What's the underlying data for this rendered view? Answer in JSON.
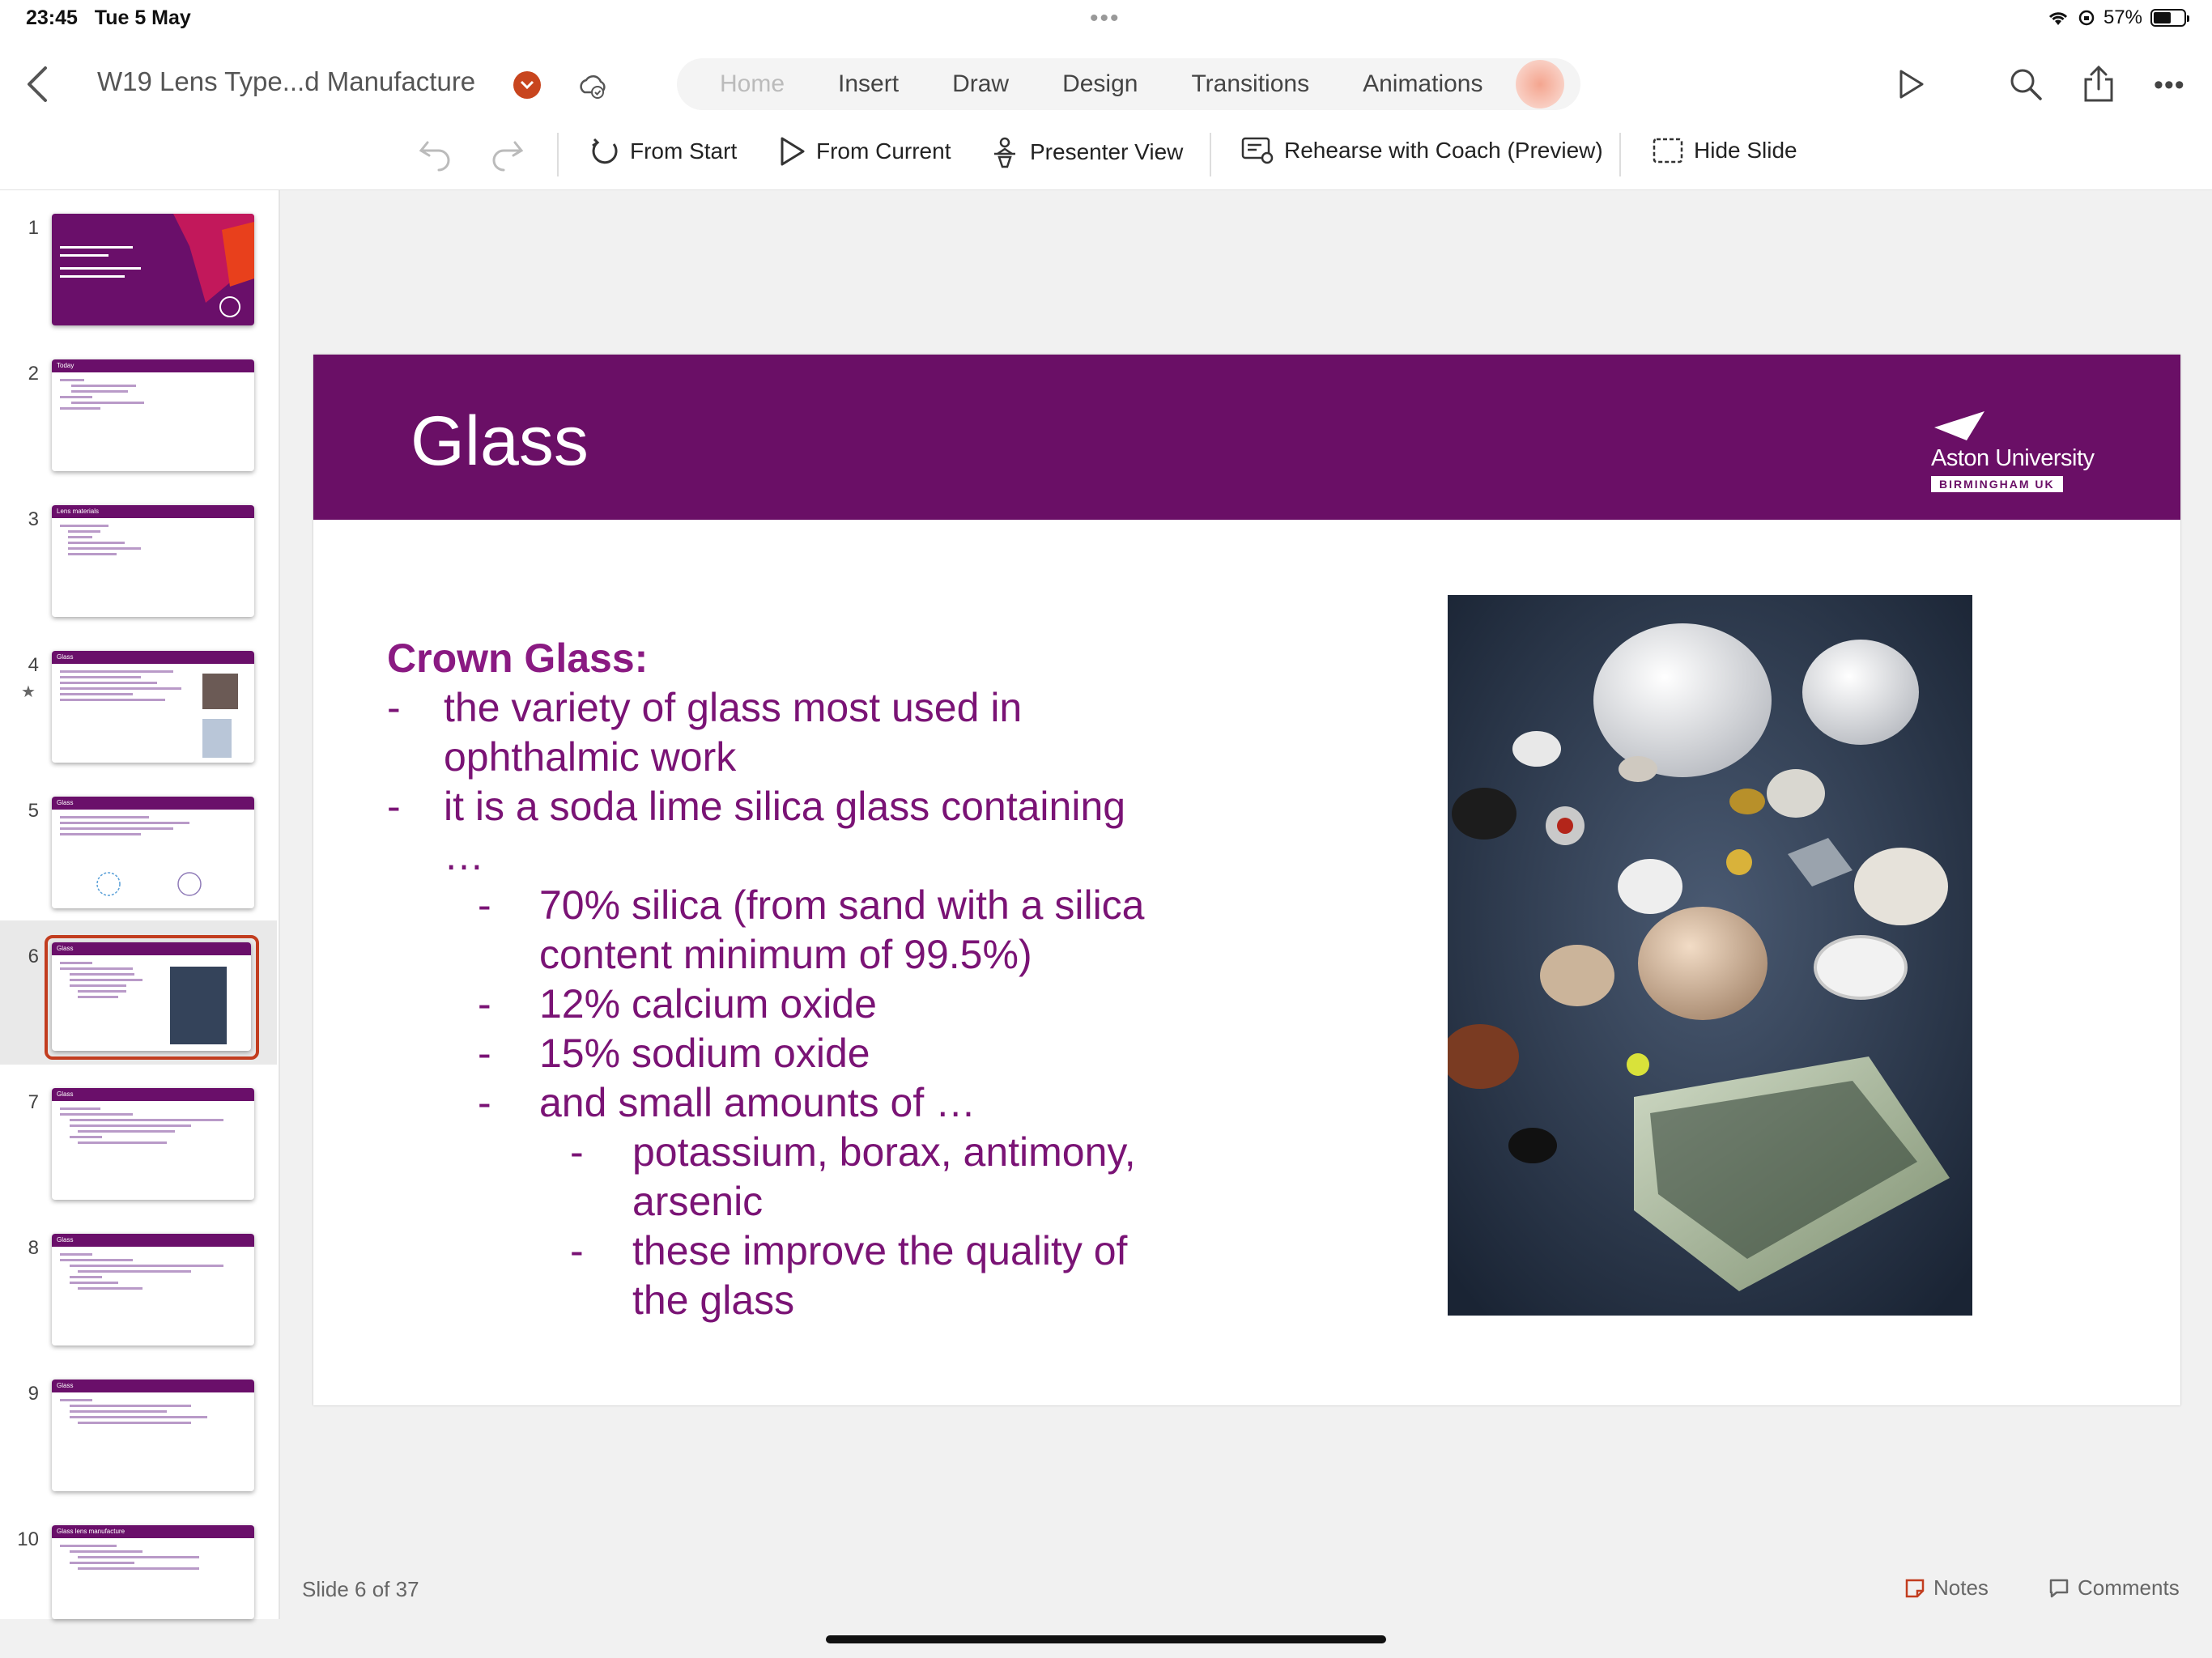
{
  "status": {
    "time": "23:45",
    "date": "Tue 5 May",
    "battery": "57%",
    "battery_level": 0.57
  },
  "header": {
    "title": "W19 Lens Type...d Manufacture",
    "tabs": [
      "Home",
      "Insert",
      "Draw",
      "Design",
      "Transitions",
      "Animations"
    ],
    "active_tab": "Home"
  },
  "ribbon": {
    "from_start": "From Start",
    "from_current": "From Current",
    "presenter_view": "Presenter View",
    "rehearse": "Rehearse with Coach (Preview)",
    "hide_slide": "Hide Slide"
  },
  "thumbnails": [
    {
      "num": "1",
      "title": ""
    },
    {
      "num": "2",
      "title": "Today"
    },
    {
      "num": "3",
      "title": "Lens materials"
    },
    {
      "num": "4",
      "title": "Glass"
    },
    {
      "num": "5",
      "title": "Glass"
    },
    {
      "num": "6",
      "title": "Glass"
    },
    {
      "num": "7",
      "title": "Glass"
    },
    {
      "num": "8",
      "title": "Glass"
    },
    {
      "num": "9",
      "title": "Glass"
    },
    {
      "num": "10",
      "title": "Glass lens manufacture"
    }
  ],
  "slide": {
    "title": "Glass",
    "logo_name": "Aston University",
    "logo_sub": "BIRMINGHAM UK",
    "heading": "Crown Glass:",
    "l1a": "the variety of glass most used in",
    "l1b": "ophthalmic work",
    "l2a": "it is a soda lime silica glass containing",
    "l2b": "…",
    "l3a": "70% silica (from sand with a silica",
    "l3b": "content minimum of 99.5%)",
    "l4": "12% calcium oxide",
    "l5": "15% sodium oxide",
    "l6": "and small amounts of …",
    "l7a": "potassium, borax, antimony,",
    "l7b": "arsenic",
    "l8a": "these improve the quality of",
    "l8b": "the glass",
    "dash": "-"
  },
  "footer": {
    "slide_count": "Slide 6 of 37",
    "notes": "Notes",
    "comments": "Comments"
  }
}
